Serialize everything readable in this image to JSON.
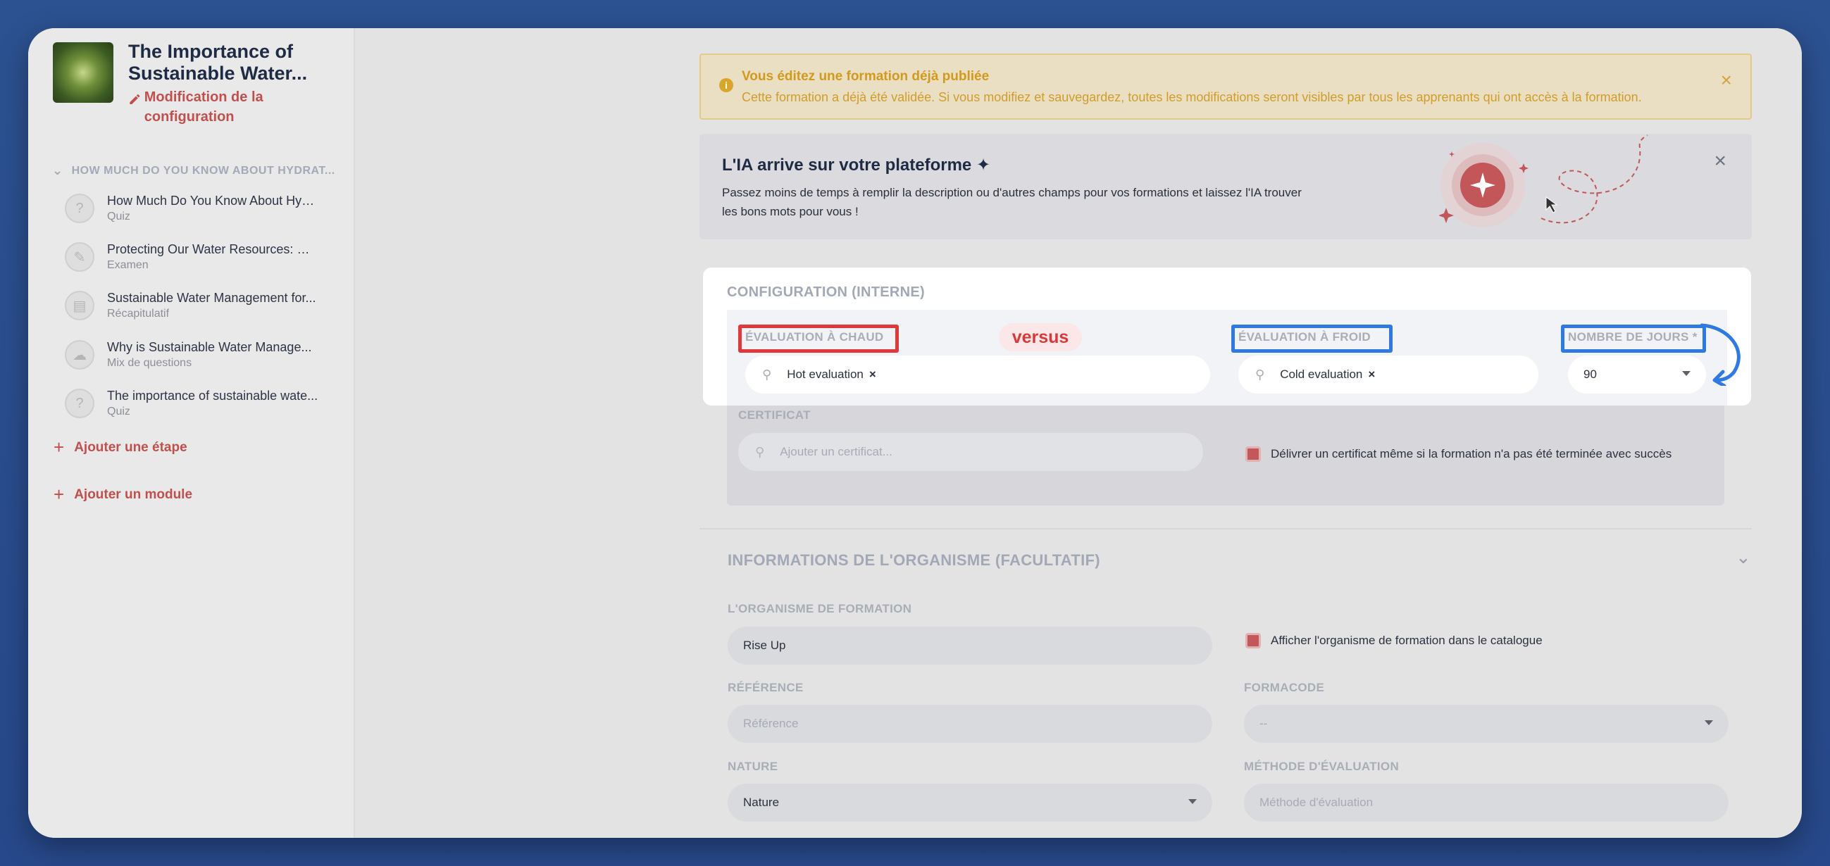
{
  "sidebar": {
    "course_title": "The Importance of Sustainable Water...",
    "edit_config": "Modification de la configuration",
    "module_header": "HOW MUCH DO YOU KNOW ABOUT HYDRAT...",
    "steps": [
      {
        "title": "How Much Do You Know About Hyd...",
        "type": "Quiz",
        "icon": "question-icon"
      },
      {
        "title": "Protecting Our Water Resources: W...",
        "type": "Examen",
        "icon": "pencil-icon"
      },
      {
        "title": "Sustainable Water Management for...",
        "type": "Récapitulatif",
        "icon": "summary-icon"
      },
      {
        "title": "Why is Sustainable Water Manage...",
        "type": "Mix de questions",
        "icon": "mix-icon"
      },
      {
        "title": "The importance of sustainable wate...",
        "type": "Quiz",
        "icon": "question-icon"
      }
    ],
    "add_step": "Ajouter une étape",
    "add_module": "Ajouter un module"
  },
  "alert": {
    "title": "Vous éditez une formation déjà publiée",
    "text": "Cette formation a déjà été validée. Si vous modifiez et sauvegardez, toutes les modifications seront visibles par tous les apprenants qui ont accès à la formation.",
    "close": "×"
  },
  "ia_banner": {
    "title": "L'IA arrive sur votre plateforme ✦",
    "text": "Passez moins de temps à remplir la description ou d'autres champs pour vos formations et laissez l'IA trouver les bons mots pour vous !",
    "close": "×"
  },
  "config": {
    "section_title": "CONFIGURATION (INTERNE)",
    "hot_label": "ÉVALUATION À CHAUD",
    "hot_value": "Hot evaluation",
    "versus": "versus",
    "cold_label": "ÉVALUATION À FROID",
    "cold_value": "Cold evaluation",
    "days_label": "NOMBRE DE JOURS *",
    "days_value": "90",
    "certificate_label": "CERTIFICAT",
    "certificate_placeholder": "Ajouter un certificat...",
    "certificate_check": "Délivrer un certificat même si la formation n'a pas été terminée avec succès",
    "tag_remove": "×"
  },
  "organisme": {
    "section_title": "INFORMATIONS DE L'ORGANISME (FACULTATIF)",
    "org_label": "L'ORGANISME DE FORMATION",
    "org_value": "Rise Up",
    "org_check": "Afficher l'organisme de formation dans le catalogue",
    "ref_label": "RÉFÉRENCE",
    "ref_placeholder": "Référence",
    "formacode_label": "FORMACODE",
    "formacode_value": "--",
    "nature_label": "NATURE",
    "nature_value": "Nature",
    "method_label": "MÉTHODE D'ÉVALUATION",
    "method_placeholder": "Méthode d'évaluation"
  },
  "colors": {
    "accent_red": "#c0504d",
    "highlight_red": "#e0393b",
    "highlight_blue": "#2f7ae0"
  }
}
